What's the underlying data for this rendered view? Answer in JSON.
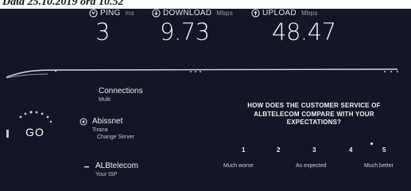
{
  "caption": "Data 25.10.2019 ora 10.52",
  "metrics": {
    "ping": {
      "label": "PING",
      "unit": "ms",
      "value": "3"
    },
    "download": {
      "label": "DOWNLOAD",
      "unit": "Mbps",
      "value": "9.73"
    },
    "upload": {
      "label": "UPLOAD",
      "unit": "Mbps",
      "value": "48.47"
    }
  },
  "go_button": "GO",
  "server": {
    "connections_label": "Connections",
    "connections_sub": "Multi",
    "host_name": "Abissnet",
    "host_sub1": "Tirana",
    "host_sub2": "Change Server",
    "isp_name": "ALBtelecom",
    "isp_sub": "Your ISP"
  },
  "survey": {
    "question": "HOW DOES THE CUSTOMER SERVICE OF ALBTELECOM COMPARE WITH YOUR EXPECTATIONS?",
    "ratings": [
      "1",
      "2",
      "3",
      "4",
      "5"
    ],
    "scale_low": "Much worse",
    "scale_mid": "As expected",
    "scale_high": "Much better"
  },
  "colors": {
    "background": "#141526",
    "accent_cyan": "#1fd8e8",
    "accent_purple": "#8a5cf0"
  }
}
